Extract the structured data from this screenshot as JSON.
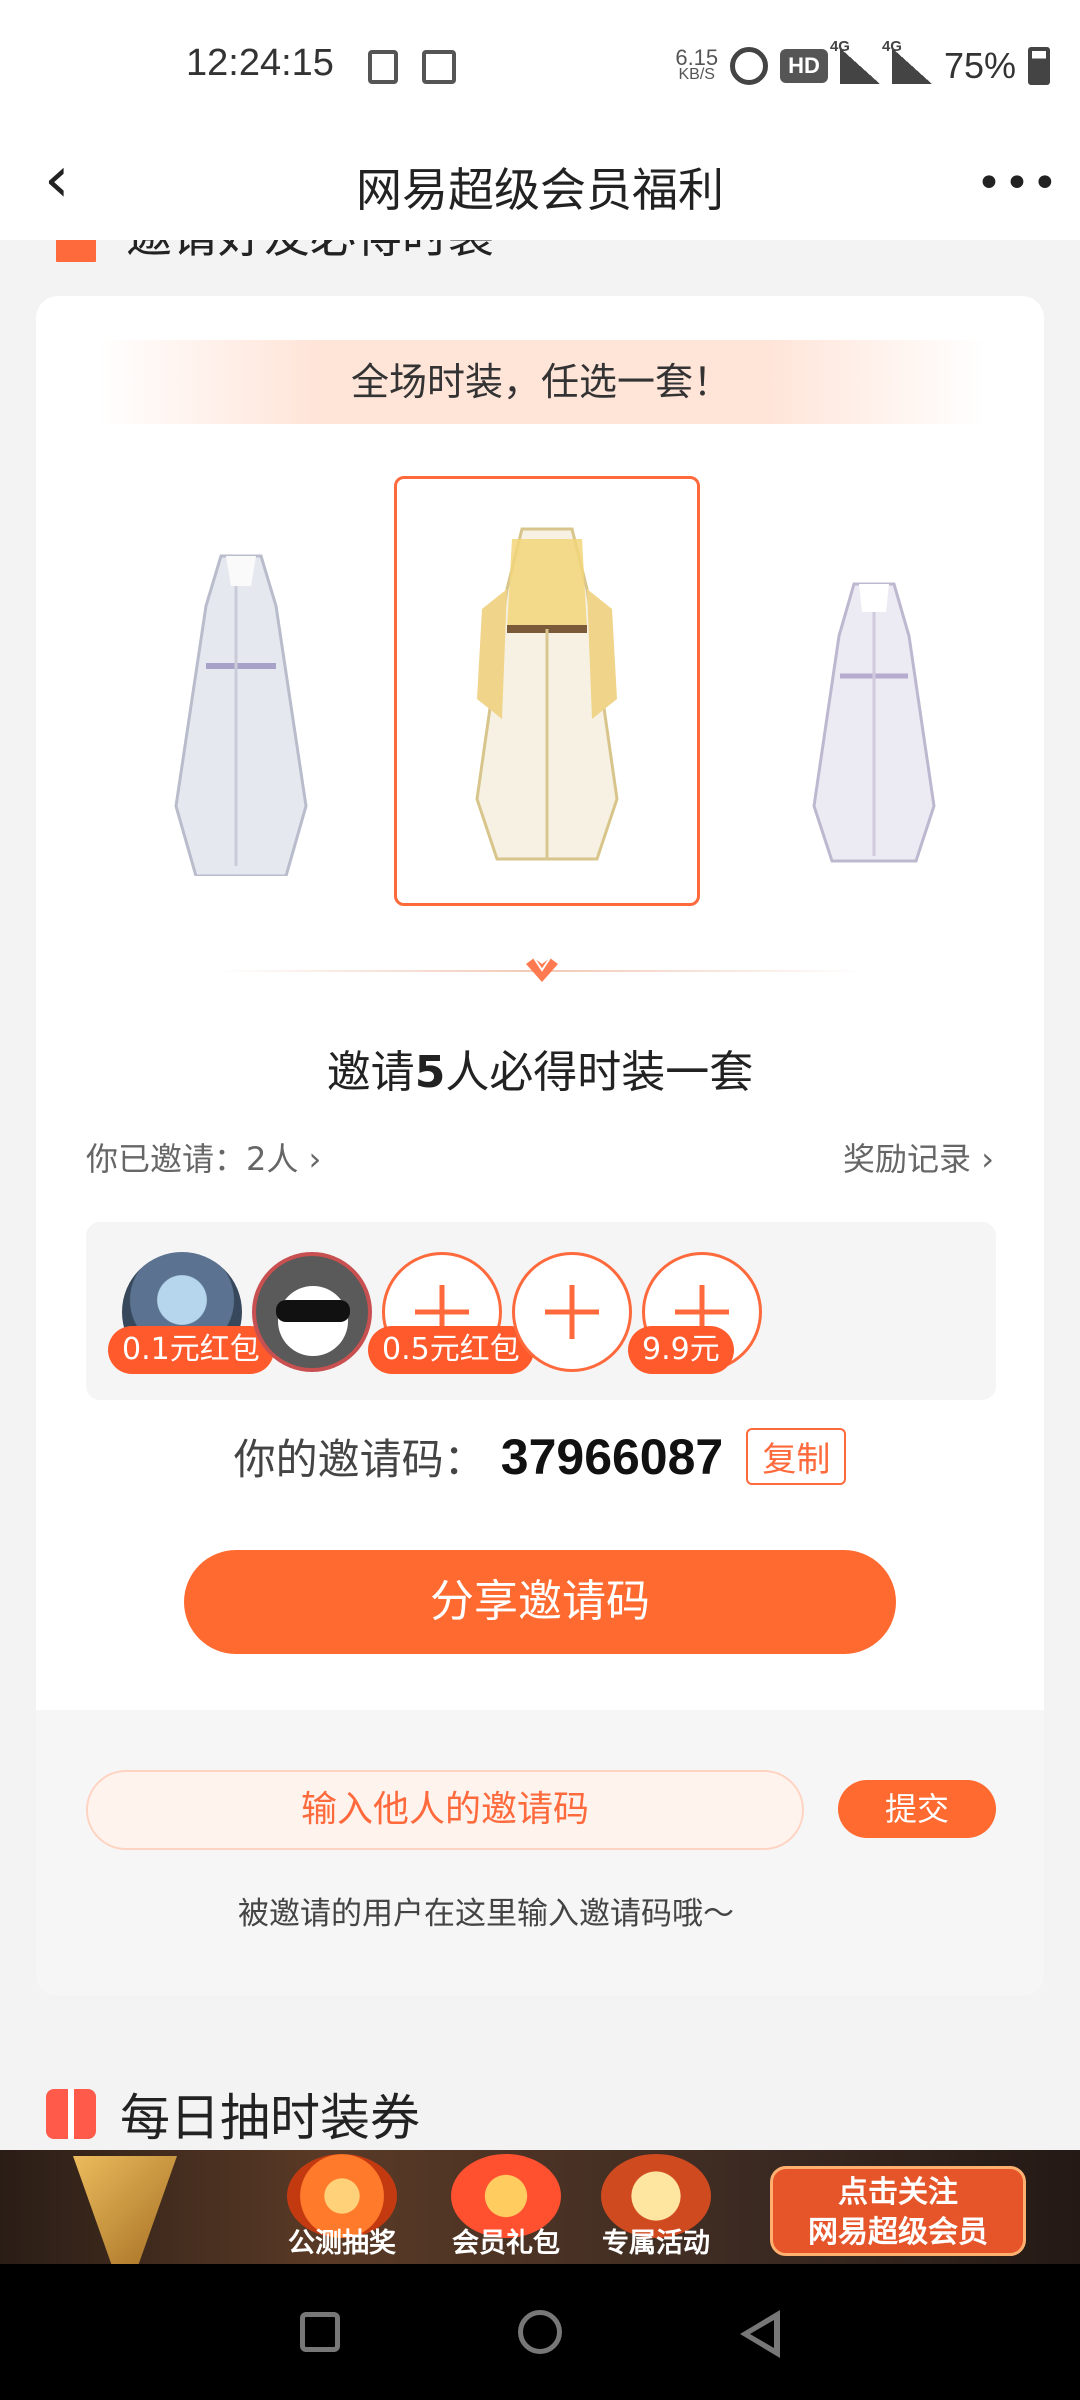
{
  "status_bar": {
    "time": "12:24:15",
    "net_speed_value": "6.15",
    "net_speed_unit": "KB/S",
    "hd_label": "HD",
    "network_1": "4G",
    "network_2": "4G",
    "battery": "75%"
  },
  "nav": {
    "back_glyph": "‹",
    "title": "网易超级会员福利",
    "more_glyph": "•••"
  },
  "top_section": {
    "title": "邀请好友必得时装"
  },
  "invite_card": {
    "banner": "全场时装，任选一套！",
    "title_prefix": "邀请",
    "title_count": "5",
    "title_suffix": "人必得时装一套",
    "invited_label": "你已邀请：2人 ›",
    "records_label": "奖励记录 ›",
    "slots": [
      {
        "type": "avatar",
        "tag": "0.1元红包"
      },
      {
        "type": "avatar",
        "tag": ""
      },
      {
        "type": "empty",
        "tag": "0.5元红包"
      },
      {
        "type": "empty",
        "tag": ""
      },
      {
        "type": "empty",
        "tag": "9.9元"
      }
    ],
    "code_label": "你的邀请码：",
    "code_value": "37966087",
    "copy_label": "复制",
    "share_label": "分享邀请码",
    "input_placeholder": "输入他人的邀请码",
    "submit_label": "提交",
    "hint": "被邀请的用户在这里输入邀请码哦～"
  },
  "daily_section": {
    "title": "每日抽时装券"
  },
  "promo_banner": {
    "items": [
      "公测抽奖",
      "会员礼包",
      "专属活动"
    ],
    "cta_line1": "点击关注",
    "cta_line2": "网易超级会员"
  },
  "colors": {
    "accent": "#ff6a30",
    "accent_light": "#fff3ee"
  }
}
